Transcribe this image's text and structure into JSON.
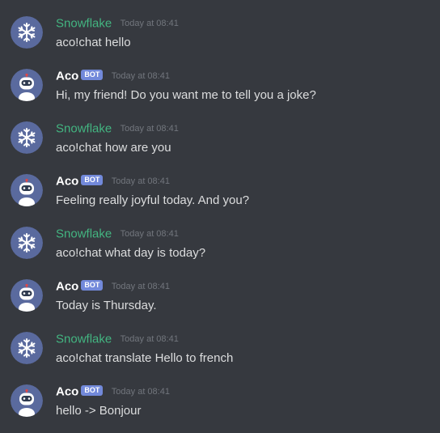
{
  "users": {
    "snowflake": {
      "name": "Snowflake",
      "color": "#43b581",
      "avatar_icon": "snowflake-icon"
    },
    "aco": {
      "name": "Aco",
      "tag": "BOT",
      "tag_color": "#7289da",
      "avatar_icon": "robot-icon"
    }
  },
  "messages": [
    {
      "author": "Snowflake",
      "time": "Today at 08:41",
      "text": "aco!chat hello"
    },
    {
      "author": "Aco",
      "tag": "BOT",
      "time": "Today at 08:41",
      "text": "Hi, my friend! Do you want me to tell you a joke?"
    },
    {
      "author": "Snowflake",
      "time": "Today at 08:41",
      "text": "aco!chat how are you"
    },
    {
      "author": "Aco",
      "tag": "BOT",
      "time": "Today at 08:41",
      "text": "Feeling really joyful today. And you?"
    },
    {
      "author": "Snowflake",
      "time": "Today at 08:41",
      "text": "aco!chat what day is today?"
    },
    {
      "author": "Aco",
      "tag": "BOT",
      "time": "Today at 08:41",
      "text": "Today is Thursday."
    },
    {
      "author": "Snowflake",
      "time": "Today at 08:41",
      "text": "aco!chat translate Hello to french"
    },
    {
      "author": "Aco",
      "tag": "BOT",
      "time": "Today at 08:41",
      "text": "hello -> Bonjour"
    }
  ]
}
